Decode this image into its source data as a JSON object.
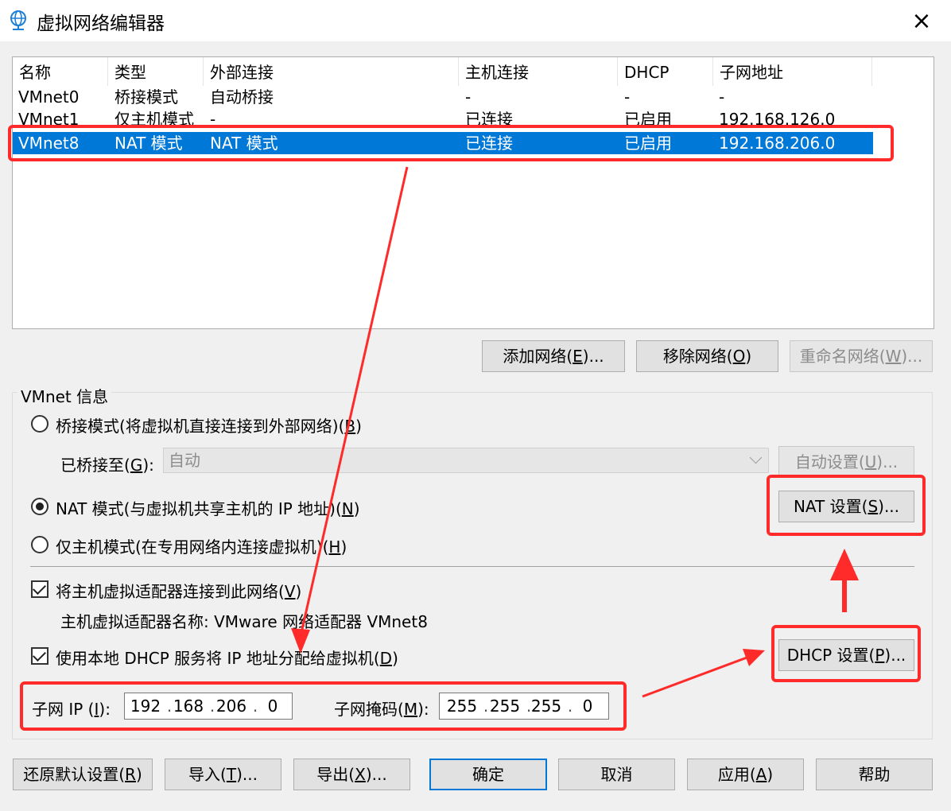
{
  "window": {
    "title": "虚拟网络编辑器",
    "close_icon": "×"
  },
  "networks": {
    "columns": [
      "名称",
      "类型",
      "外部连接",
      "主机连接",
      "DHCP",
      "子网地址"
    ],
    "rows": [
      {
        "name": "VMnet0",
        "type": "桥接模式",
        "external": "自动桥接",
        "host": "-",
        "dhcp": "-",
        "subnet": "-"
      },
      {
        "name": "VMnet1",
        "type": "仅主机模式",
        "external": "-",
        "host": "已连接",
        "dhcp": "已启用",
        "subnet": "192.168.126.0"
      },
      {
        "name": "VMnet8",
        "type": "NAT 模式",
        "external": "NAT 模式",
        "host": "已连接",
        "dhcp": "已启用",
        "subnet": "192.168.206.0",
        "selected": true
      }
    ]
  },
  "network_buttons": {
    "add": {
      "text": "添加网络(",
      "key": "E",
      "tail": ")..."
    },
    "remove": {
      "text": "移除网络(",
      "key": "O",
      "tail": ")"
    },
    "rename": {
      "text": "重命名网络(",
      "key": "W",
      "tail": ")..."
    }
  },
  "vmnet_info": {
    "group_label": "VMnet 信息",
    "bridged": {
      "text": "桥接模式(将虚拟机直接连接到外部网络)(",
      "key": "B",
      "tail": ")",
      "selected": false
    },
    "bridged_to": {
      "text": "已桥接至(",
      "key": "G",
      "tail": "):",
      "value": "自动"
    },
    "auto_settings": {
      "text": "自动设置(",
      "key": "U",
      "tail": ")..."
    },
    "nat": {
      "text": "NAT 模式(与虚拟机共享主机的 IP 地址)(",
      "key": "N",
      "tail": ")",
      "selected": true
    },
    "nat_settings": {
      "text": "NAT 设置(",
      "key": "S",
      "tail": ")..."
    },
    "host_only": {
      "text": "仅主机模式(在专用网络内连接虚拟机)(",
      "key": "H",
      "tail": ")",
      "selected": false
    },
    "connect_adapter": {
      "text": "将主机虚拟适配器连接到此网络(",
      "key": "V",
      "tail": ")",
      "checked": true
    },
    "adapter_name": "主机虚拟适配器名称: VMware 网络适配器 VMnet8",
    "use_dhcp": {
      "text": "使用本地 DHCP 服务将 IP 地址分配给虚拟机(",
      "key": "D",
      "tail": ")",
      "checked": true
    },
    "dhcp_settings": {
      "text": "DHCP 设置(",
      "key": "P",
      "tail": ")..."
    },
    "subnet_ip": {
      "text": "子网 IP (",
      "key": "I",
      "tail": "):",
      "octets": [
        "192",
        "168",
        "206",
        "0"
      ]
    },
    "subnet_mask": {
      "text": "子网掩码(",
      "key": "M",
      "tail": "):",
      "octets": [
        "255",
        "255",
        "255",
        "0"
      ]
    }
  },
  "footer": {
    "restore": {
      "text": "还原默认设置(",
      "key": "R",
      "tail": ")"
    },
    "import": {
      "text": "导入(",
      "key": "T",
      "tail": ")..."
    },
    "export": {
      "text": "导出(",
      "key": "X",
      "tail": ")..."
    },
    "ok": "确定",
    "cancel": "取消",
    "apply": {
      "text": "应用(",
      "key": "A",
      "tail": ")"
    },
    "help": "帮助"
  },
  "colors": {
    "selection": "#0078d7",
    "annotation": "#ff2a2a",
    "background": "#f0f0f0"
  }
}
